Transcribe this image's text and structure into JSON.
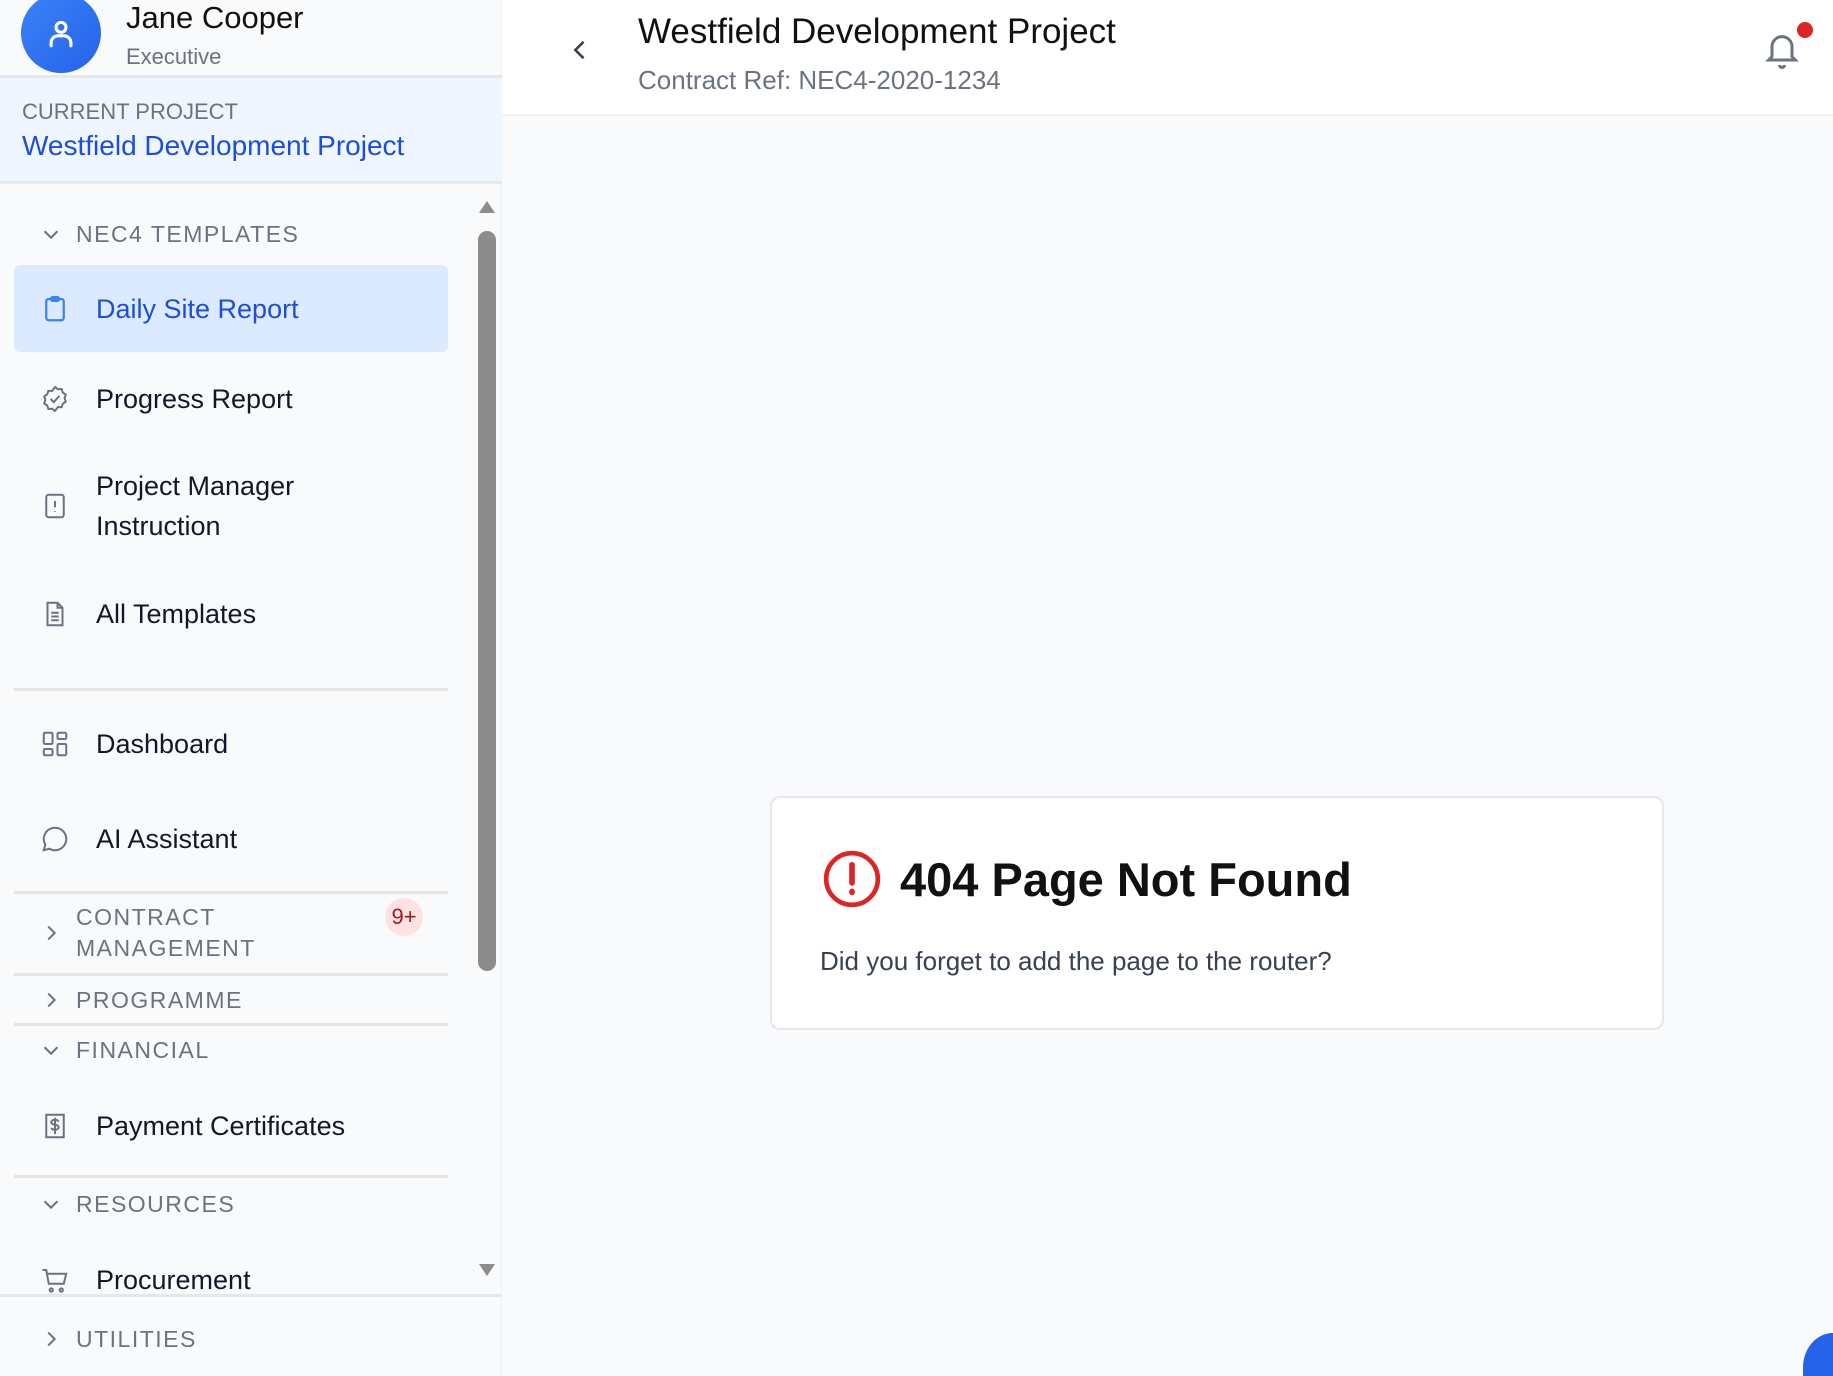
{
  "user": {
    "name": "Jane Cooper",
    "role": "Executive"
  },
  "current_project": {
    "label": "CURRENT PROJECT",
    "name": "Westfield Development Project"
  },
  "sidebar": {
    "sections": {
      "nec4": "NEC4 TEMPLATES",
      "contract_line1": "CONTRACT",
      "contract_line2": "MANAGEMENT",
      "programme": "PROGRAMME",
      "financial": "FINANCIAL",
      "resources": "RESOURCES",
      "utilities": "UTILITIES"
    },
    "items": {
      "daily": "Daily Site Report",
      "progress": "Progress Report",
      "pmi_line1": "Project Manager",
      "pmi_line2": "Instruction",
      "all_templates": "All Templates",
      "dashboard": "Dashboard",
      "ai": "AI Assistant",
      "payment": "Payment Certificates",
      "procurement": "Procurement"
    },
    "contract_badge": "9+"
  },
  "header": {
    "title": "Westfield Development Project",
    "subtitle": "Contract Ref: NEC4-2020-1234"
  },
  "error": {
    "title": "404 Page Not Found",
    "message": "Did you forget to add the page to the router?"
  },
  "colors": {
    "accent": "#1d4ed8",
    "error": "#dc2626",
    "notification": "#dc2626"
  }
}
